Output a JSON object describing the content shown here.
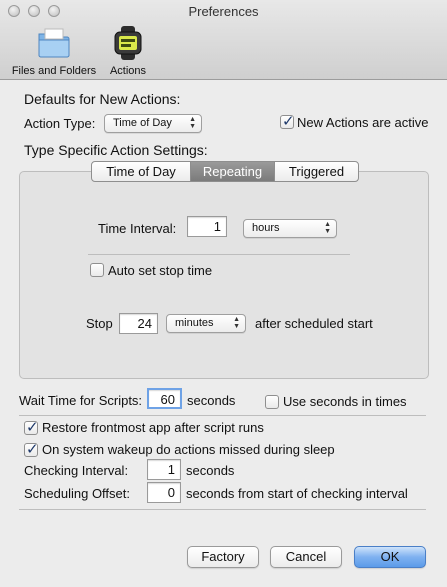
{
  "window": {
    "title": "Preferences"
  },
  "toolbar": {
    "items": [
      {
        "label": "Files and Folders",
        "icon": "folder-icon"
      },
      {
        "label": "Actions",
        "icon": "watch-icon"
      }
    ]
  },
  "defaults": {
    "heading": "Defaults for New Actions:",
    "action_type_label": "Action Type:",
    "action_type_value": "Time of Day",
    "new_actions_active_label": "New Actions are active",
    "new_actions_active_checked": true
  },
  "specific": {
    "heading": "Type Specific Action Settings:",
    "tabs": [
      {
        "label": "Time of Day",
        "selected": false
      },
      {
        "label": "Repeating",
        "selected": true
      },
      {
        "label": "Triggered",
        "selected": false
      }
    ],
    "time_interval_label": "Time Interval:",
    "time_interval_value": "1",
    "time_interval_unit": "hours",
    "auto_stop_label": "Auto set stop time",
    "auto_stop_checked": false,
    "stop_label": "Stop",
    "stop_value": "24",
    "stop_unit": "minutes",
    "stop_suffix": "after scheduled start"
  },
  "general": {
    "wait_time_label": "Wait Time for Scripts:",
    "wait_time_value": "60",
    "wait_time_suffix": "seconds",
    "use_seconds_label": "Use seconds in times",
    "use_seconds_checked": false,
    "restore_label": "Restore frontmost app after script runs",
    "restore_checked": true,
    "wakeup_label": "On system wakeup do actions missed during sleep",
    "wakeup_checked": true,
    "checking_interval_label": "Checking Interval:",
    "checking_interval_value": "1",
    "checking_interval_suffix": "seconds",
    "scheduling_offset_label": "Scheduling Offset:",
    "scheduling_offset_value": "0",
    "scheduling_offset_suffix": "seconds from start of checking interval"
  },
  "buttons": {
    "factory": "Factory",
    "cancel": "Cancel",
    "ok": "OK"
  },
  "colors": {
    "default_button": "#5b9be9",
    "selected_tab": "#7b7b7b",
    "checkmark": "#1f3a6b"
  }
}
